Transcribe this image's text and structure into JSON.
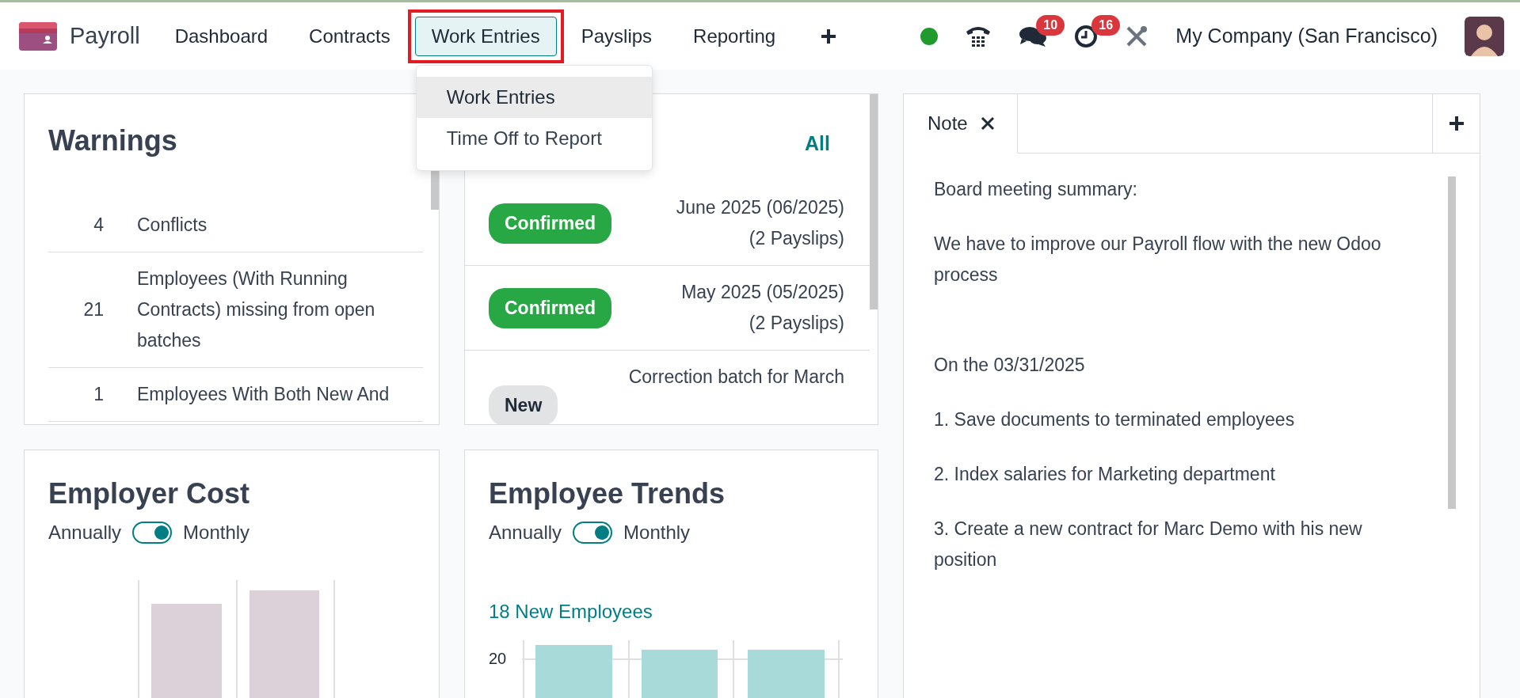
{
  "app": {
    "name": "Payroll"
  },
  "menu": [
    {
      "label": "Dashboard",
      "selected": false,
      "highlighted": false
    },
    {
      "label": "Contracts",
      "selected": false,
      "highlighted": false
    },
    {
      "label": "Work Entries",
      "selected": true,
      "highlighted": true
    },
    {
      "label": "Payslips",
      "selected": false,
      "highlighted": false
    },
    {
      "label": "Reporting",
      "selected": false,
      "highlighted": false
    }
  ],
  "dropdown": [
    {
      "label": "Work Entries",
      "selected": true
    },
    {
      "label": "Time Off to Report",
      "selected": false
    }
  ],
  "systray": {
    "messages_badge": "10",
    "activities_badge": "16",
    "company": "My Company (San Francisco)"
  },
  "warnings": {
    "title": "Warnings",
    "rows": [
      {
        "count": "4",
        "label": "Conflicts"
      },
      {
        "count": "21",
        "label": "Employees (With Running Contracts) missing from open batches"
      },
      {
        "count": "1",
        "label": "Employees With Both New And"
      }
    ]
  },
  "batches": {
    "link": "All",
    "rows": [
      {
        "status": "Confirmed",
        "kind": "confirmed",
        "name": "June 2025 (06/2025)",
        "payslips": "(2 Payslips)"
      },
      {
        "status": "Confirmed",
        "kind": "confirmed",
        "name": "May 2025 (05/2025)",
        "payslips": "(2 Payslips)"
      },
      {
        "status": "New",
        "kind": "new",
        "name": "Correction batch for March"
      }
    ]
  },
  "employer_cost": {
    "title": "Employer Cost",
    "toggle": {
      "left": "Annually",
      "right": "Monthly",
      "on": true
    }
  },
  "employee_trends": {
    "title": "Employee Trends",
    "toggle": {
      "left": "Annually",
      "right": "Monthly",
      "on": true
    },
    "summary": "18 New Employees",
    "y_tick": "20"
  },
  "note": {
    "tabs": [
      {
        "label": "Note",
        "selected": true
      }
    ],
    "blocks": [
      [
        "Board meeting summary:",
        "We have to improve our Payroll flow with the new Odoo process"
      ],
      [
        "On the 03/31/2025",
        "1. Save documents to terminated employees",
        "2. Index salaries for Marketing department",
        "3. Create a new contract for Marc Demo with his new position"
      ]
    ]
  }
}
